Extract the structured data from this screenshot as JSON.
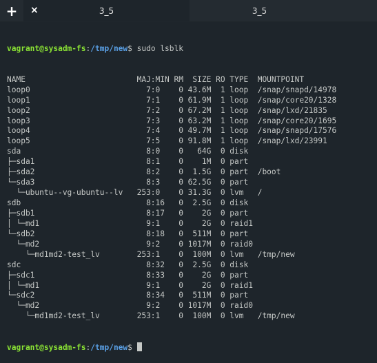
{
  "tabs": [
    {
      "label": "3_5",
      "close_icon": "×",
      "active": true
    },
    {
      "label": "3_5",
      "active": false
    }
  ],
  "new_tab_icon": "+",
  "prompt": {
    "user_host": "vagrant@sysadm-fs",
    "separator": ":",
    "path": "/tmp/new",
    "dollar": "$"
  },
  "command": " sudo lsblk",
  "output": [
    "NAME                        MAJ:MIN RM  SIZE RO TYPE  MOUNTPOINT",
    "loop0                         7:0    0 43.6M  1 loop  /snap/snapd/14978",
    "loop1                         7:1    0 61.9M  1 loop  /snap/core20/1328",
    "loop2                         7:2    0 67.2M  1 loop  /snap/lxd/21835",
    "loop3                         7:3    0 63.2M  1 loop  /snap/core20/1695",
    "loop4                         7:4    0 49.7M  1 loop  /snap/snapd/17576",
    "loop5                         7:5    0 91.8M  1 loop  /snap/lxd/23991",
    "sda                           8:0    0   64G  0 disk",
    "├─sda1                        8:1    0    1M  0 part",
    "├─sda2                        8:2    0  1.5G  0 part  /boot",
    "└─sda3                        8:3    0 62.5G  0 part",
    "  └─ubuntu--vg-ubuntu--lv   253:0    0 31.3G  0 lvm   /",
    "sdb                           8:16   0  2.5G  0 disk",
    "├─sdb1                        8:17   0    2G  0 part",
    "│ └─md1                       9:1    0    2G  0 raid1",
    "└─sdb2                        8:18   0  511M  0 part",
    "  └─md2                       9:2    0 1017M  0 raid0",
    "    └─md1md2-test_lv        253:1    0  100M  0 lvm   /tmp/new",
    "sdc                           8:32   0  2.5G  0 disk",
    "├─sdc1                        8:33   0    2G  0 part",
    "│ └─md1                       9:1    0    2G  0 raid1",
    "└─sdc2                        8:34   0  511M  0 part",
    "  └─md2                       9:2    0 1017M  0 raid0",
    "    └─md1md2-test_lv        253:1    0  100M  0 lvm   /tmp/new"
  ],
  "colors": {
    "background": "#1e252b",
    "prompt_user": "#8ae234",
    "prompt_path": "#5aa0e6",
    "text": "#c5c8c6"
  }
}
